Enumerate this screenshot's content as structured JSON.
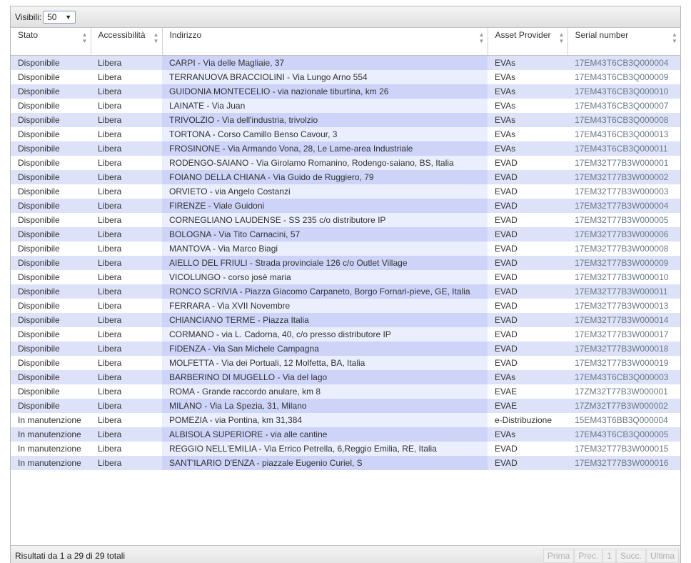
{
  "toolbar": {
    "label": "Visibili:",
    "page_size": "50"
  },
  "columns": {
    "stato": "Stato",
    "accessibilita": "Accessibilità",
    "indirizzo": "Indirizzo",
    "asset_provider": "Asset Provider",
    "serial": "Serial number"
  },
  "rows": [
    {
      "stato": "Disponibile",
      "acc": "Libera",
      "addr": "CARPI - Via delle Magliaie, 37",
      "provider": "EVAs",
      "serial": "17EM43T6CB3Q000004"
    },
    {
      "stato": "Disponibile",
      "acc": "Libera",
      "addr": "TERRANUOVA BRACCIOLINI - Via Lungo Arno 554",
      "provider": "EVAs",
      "serial": "17EM43T6CB3Q000009"
    },
    {
      "stato": "Disponibile",
      "acc": "Libera",
      "addr": "GUIDONIA MONTECELIO - via nazionale tiburtina, km 26",
      "provider": "EVAs",
      "serial": "17EM43T6CB3Q000010"
    },
    {
      "stato": "Disponibile",
      "acc": "Libera",
      "addr": "LAINATE - Via Juan",
      "provider": "EVAs",
      "serial": "17EM43T6CB3Q000007"
    },
    {
      "stato": "Disponibile",
      "acc": "Libera",
      "addr": "TRIVOLZIO - Via dell'industria, trivolzio",
      "provider": "EVAs",
      "serial": "17EM43T6CB3Q000008"
    },
    {
      "stato": "Disponibile",
      "acc": "Libera",
      "addr": "TORTONA - Corso Camillo Benso Cavour, 3",
      "provider": "EVAs",
      "serial": "17EM43T6CB3Q000013"
    },
    {
      "stato": "Disponibile",
      "acc": "Libera",
      "addr": "FROSINONE - Via Armando Vona, 28, Le Lame-area Industriale",
      "provider": "EVAs",
      "serial": "17EM43T6CB3Q000011"
    },
    {
      "stato": "Disponibile",
      "acc": "Libera",
      "addr": "RODENGO-SAIANO - Via Girolamo Romanino, Rodengo-saiano, BS, Italia",
      "provider": "EVAD",
      "serial": "17EM32T77B3W000001"
    },
    {
      "stato": "Disponibile",
      "acc": "Libera",
      "addr": "FOIANO DELLA CHIANA - Via Guido de Ruggiero, 79",
      "provider": "EVAD",
      "serial": "17EM32T77B3W000002"
    },
    {
      "stato": "Disponibile",
      "acc": "Libera",
      "addr": "ORVIETO - via Angelo Costanzi",
      "provider": "EVAD",
      "serial": "17EM32T77B3W000003"
    },
    {
      "stato": "Disponibile",
      "acc": "Libera",
      "addr": "FIRENZE - Viale Guidoni",
      "provider": "EVAD",
      "serial": "17EM32T77B3W000004"
    },
    {
      "stato": "Disponibile",
      "acc": "Libera",
      "addr": "CORNEGLIANO LAUDENSE - SS 235 c/o distributore IP",
      "provider": "EVAD",
      "serial": "17EM32T77B3W000005"
    },
    {
      "stato": "Disponibile",
      "acc": "Libera",
      "addr": "BOLOGNA - Via Tito Carnacini, 57",
      "provider": "EVAD",
      "serial": "17EM32T77B3W000006"
    },
    {
      "stato": "Disponibile",
      "acc": "Libera",
      "addr": "MANTOVA - Via Marco Biagi",
      "provider": "EVAD",
      "serial": "17EM32T77B3W000008"
    },
    {
      "stato": "Disponibile",
      "acc": "Libera",
      "addr": "AIELLO DEL FRIULI - Strada provinciale 126 c/o Outlet Village",
      "provider": "EVAD",
      "serial": "17EM32T77B3W000009"
    },
    {
      "stato": "Disponibile",
      "acc": "Libera",
      "addr": "VICOLUNGO - corso josè maria",
      "provider": "EVAD",
      "serial": "17EM32T77B3W000010"
    },
    {
      "stato": "Disponibile",
      "acc": "Libera",
      "addr": "RONCO SCRIVIA - Piazza Giacomo Carpaneto, Borgo Fornari-pieve, GE, Italia",
      "provider": "EVAD",
      "serial": "17EM32T77B3W000011"
    },
    {
      "stato": "Disponibile",
      "acc": "Libera",
      "addr": "FERRARA - Via XVII Novembre",
      "provider": "EVAD",
      "serial": "17EM32T77B3W000013"
    },
    {
      "stato": "Disponibile",
      "acc": "Libera",
      "addr": "CHIANCIANO TERME - Piazza Italia",
      "provider": "EVAD",
      "serial": "17EM32T77B3W000014"
    },
    {
      "stato": "Disponibile",
      "acc": "Libera",
      "addr": "CORMANO - via L. Cadorna, 40, c/o presso distributore IP",
      "provider": "EVAD",
      "serial": "17EM32T77B3W000017"
    },
    {
      "stato": "Disponibile",
      "acc": "Libera",
      "addr": "FIDENZA - Via San Michele Campagna",
      "provider": "EVAD",
      "serial": "17EM32T77B3W000018"
    },
    {
      "stato": "Disponibile",
      "acc": "Libera",
      "addr": "MOLFETTA - Via dei Portuali, 12 Molfetta, BA, Italia",
      "provider": "EVAD",
      "serial": "17EM32T77B3W000019"
    },
    {
      "stato": "Disponibile",
      "acc": "Libera",
      "addr": "BARBERINO DI MUGELLO - Via del lago",
      "provider": "EVAs",
      "serial": "17EM43T6CB3Q000003"
    },
    {
      "stato": "Disponibile",
      "acc": "Libera",
      "addr": "ROMA - Grande raccordo anulare, km 8",
      "provider": "EVAE",
      "serial": "17ZM32T77B3W000001"
    },
    {
      "stato": "Disponibile",
      "acc": "Libera",
      "addr": "MILANO - Via La Spezia, 31, Milano",
      "provider": "EVAE",
      "serial": "17ZM32T77B3W000002"
    },
    {
      "stato": "In manutenzione",
      "acc": "Libera",
      "addr": "POMEZIA - via Pontina, km 31,384",
      "provider": "e-Distribuzione",
      "serial": "15EM43T6BB3Q000004"
    },
    {
      "stato": "In manutenzione",
      "acc": "Libera",
      "addr": "ALBISOLA SUPERIORE - via alle cantine",
      "provider": "EVAs",
      "serial": "17EM43T6CB3Q000005"
    },
    {
      "stato": "In manutenzione",
      "acc": "Libera",
      "addr": "REGGIO NELL'EMILIA - Via Errico Petrella, 6,Reggio Emilia, RE, Italia",
      "provider": "EVAD",
      "serial": "17EM32T77B3W000015"
    },
    {
      "stato": "In manutenzione",
      "acc": "Libera",
      "addr": "SANT'ILARIO D'ENZA - piazzale Eugenio Curiel, S",
      "provider": "EVAD",
      "serial": "17EM32T77B3W000016"
    }
  ],
  "footer": {
    "summary": "Risultati da 1 a 29 di 29 totali",
    "pager": {
      "first": "Prima",
      "prev": "Prec.",
      "page": "1",
      "next": "Succ.",
      "last": "Ultima"
    }
  },
  "colors": {
    "row_odd": "#dde2f8",
    "row_even": "#ffffff",
    "sorted_odd": "#cdd4f8",
    "sorted_even": "#eaeefd"
  }
}
